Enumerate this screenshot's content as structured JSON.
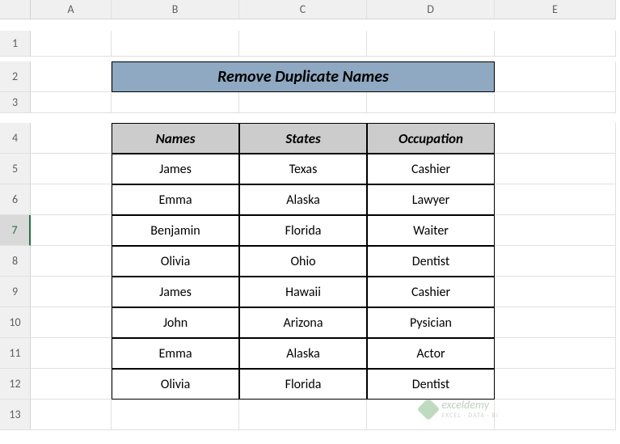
{
  "columns": [
    "A",
    "B",
    "C",
    "D",
    "E"
  ],
  "rows": [
    "1",
    "2",
    "3",
    "4",
    "5",
    "6",
    "7",
    "8",
    "9",
    "10",
    "11",
    "12",
    "13"
  ],
  "selected_row": "7",
  "title": "Remove Duplicate Names",
  "headers": [
    "Names",
    "States",
    "Occupation"
  ],
  "chart_data": {
    "type": "table",
    "title": "Remove Duplicate Names",
    "columns": [
      "Names",
      "States",
      "Occupation"
    ],
    "rows": [
      [
        "James",
        "Texas",
        "Cashier"
      ],
      [
        "Emma",
        "Alaska",
        "Lawyer"
      ],
      [
        "Benjamin",
        "Florida",
        "Waiter"
      ],
      [
        "Olivia",
        "Ohio",
        "Dentist"
      ],
      [
        "James",
        "Hawaii",
        "Cashier"
      ],
      [
        "John",
        "Arizona",
        "Pysician"
      ],
      [
        "Emma",
        "Alaska",
        "Actor"
      ],
      [
        "Olivia",
        "Florida",
        "Dentist"
      ]
    ]
  },
  "watermark": {
    "brand": "exceldemy",
    "tagline": "EXCEL · DATA · BI"
  }
}
